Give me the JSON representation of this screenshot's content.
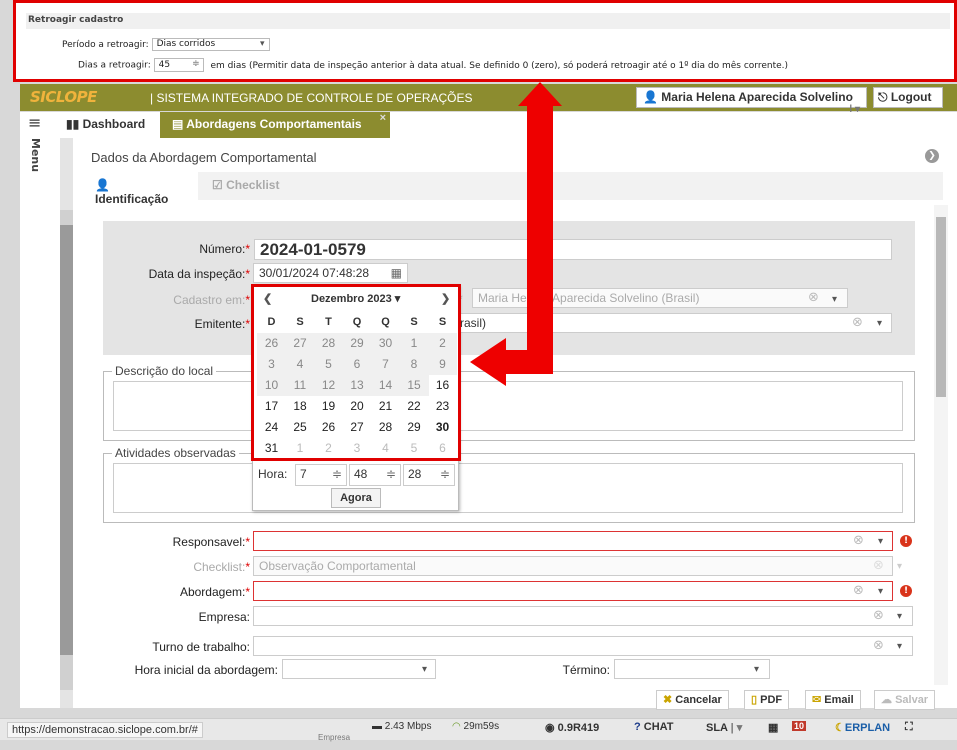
{
  "retro": {
    "title": "Retroagir cadastro",
    "period_label": "Período a retroagir:",
    "period_value": "Dias corridos",
    "days_label": "Dias a retroagir:",
    "days_value": "45",
    "days_help": "em dias (Permitir data de inspeção anterior à data atual. Se definido 0 (zero), só poderá retroagir até o 1º dia do mês corrente.)"
  },
  "header": {
    "logo": "SICLOPE",
    "system_name": "| SISTEMA INTEGRADO DE CONTROLE DE OPERAÇÕES",
    "user": "Maria Helena Aparecida Solvelino",
    "logout": "Logout"
  },
  "tabs": {
    "dashboard": "Dashboard",
    "abordagens": "Abordagens Comportamentais",
    "close": "×"
  },
  "sidebar": {
    "menu": "Menu"
  },
  "panel": {
    "title": "Dados da Abordagem Comportamental",
    "tab_ident": "Identificação",
    "tab_check": "Checklist"
  },
  "form": {
    "numero_label": "Número:",
    "numero_value": "2024-01-0579",
    "data_label": "Data da inspeção:",
    "data_value": "30/01/2024 07:48:28",
    "cadastro_label": "Cadastro em:",
    "cadastrado_value": "Maria Helena Aparecida Solvelino (Brasil)",
    "emitente_label": "Emitente:",
    "emitente_value": "rasil)",
    "descricao_legend": "Descrição do local",
    "atividades_legend": "Atividades observadas",
    "responsavel_label": "Responsavel:",
    "checklist_label": "Checklist:",
    "checklist_value": "Observação Comportamental",
    "abordagem_label": "Abordagem:",
    "empresa_label": "Empresa:",
    "turno_label": "Turno de trabalho:",
    "hora_inicial_label": "Hora inicial da abordagem:",
    "termino_label": "Término:",
    "required_mark": "*"
  },
  "calendar": {
    "prev": "❮",
    "next": "❯",
    "month_label": "Dezembro 2023 ▾",
    "dow": [
      "D",
      "S",
      "T",
      "Q",
      "Q",
      "S",
      "S"
    ],
    "weeks": [
      [
        "26",
        "27",
        "28",
        "29",
        "30",
        "1",
        "2"
      ],
      [
        "3",
        "4",
        "5",
        "6",
        "7",
        "8",
        "9"
      ],
      [
        "10",
        "11",
        "12",
        "13",
        "14",
        "15",
        "16"
      ],
      [
        "17",
        "18",
        "19",
        "20",
        "21",
        "22",
        "23"
      ],
      [
        "24",
        "25",
        "26",
        "27",
        "28",
        "29",
        "30"
      ],
      [
        "31",
        "1",
        "2",
        "3",
        "4",
        "5",
        "6"
      ]
    ],
    "hora_label": "Hora:",
    "hour": "7",
    "minute": "48",
    "second": "28",
    "agora": "Agora"
  },
  "footer": {
    "cancelar": "Cancelar",
    "pdf": "PDF",
    "email": "Email",
    "salvar": "Salvar"
  },
  "status": {
    "url": "https://demonstracao.siclope.com.br/#",
    "speed": "2.43 Mbps",
    "timer": "29m59s",
    "version": "0.9R419",
    "chat": "CHAT",
    "sla": "SLA",
    "badge": "10",
    "brand": "ERPLAN",
    "empresa_ghost": "Empresa"
  },
  "colors": {
    "accent": "#8c8c2f",
    "highlight": "#e00000",
    "logo": "#f0b33c"
  }
}
